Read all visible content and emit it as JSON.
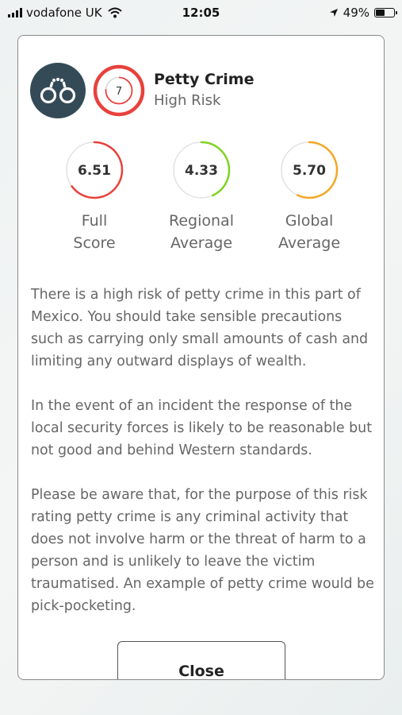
{
  "status_bar": {
    "carrier": "vodafone UK",
    "time": "12:05",
    "battery": "49%",
    "battery_level": 0.49
  },
  "risk": {
    "category_icon": "handcuffs-icon",
    "rating": "7",
    "title": "Petty Crime",
    "level": "High Risk",
    "color": "#e8413c"
  },
  "scores": [
    {
      "value": "6.51",
      "label_lines": [
        "Full",
        "Score"
      ],
      "color": "#e8413c"
    },
    {
      "value": "4.33",
      "label_lines": [
        "Regional",
        "Average"
      ],
      "color": "#7ed321"
    },
    {
      "value": "5.70",
      "label_lines": [
        "Global",
        "Average"
      ],
      "color": "#f5a623"
    }
  ],
  "paragraphs": [
    "There is a high risk of petty crime in this part of Mexico. You should take sensible precautions such as carrying only small amounts of cash and limiting any outward displays of wealth.",
    "In the event of an incident the response of the local security forces is likely to be reasonable but not good and behind Western standards.",
    "Please be aware that, for the purpose of this risk rating petty crime is any criminal activity that does not involve harm or the threat of harm to a person and is unlikely to leave the victim traumatised. An example of petty crime would be pick-pocketing."
  ],
  "close_label": "Close"
}
